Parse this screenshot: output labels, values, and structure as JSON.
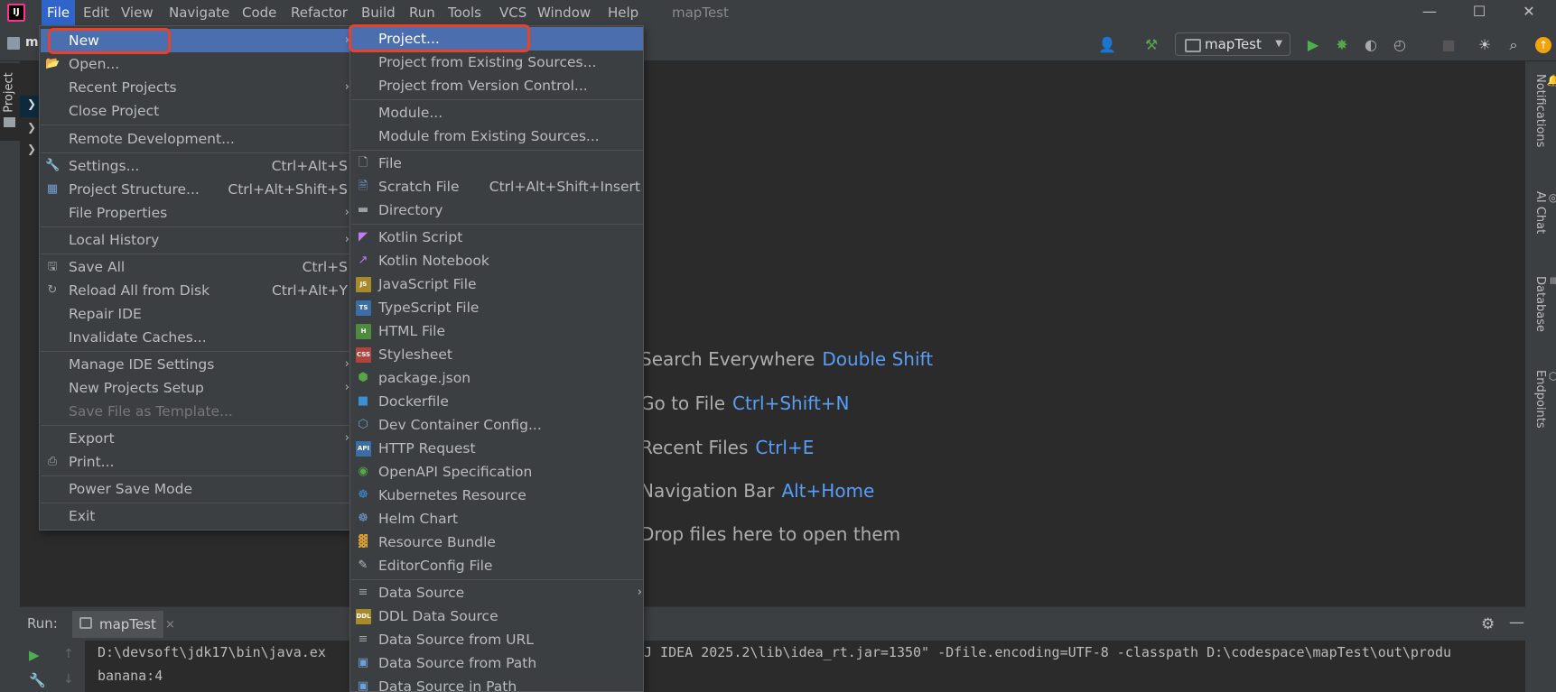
{
  "menubar": {
    "items": [
      "File",
      "Edit",
      "View",
      "Navigate",
      "Code",
      "Refactor",
      "Build",
      "Run",
      "Tools",
      "VCS",
      "Window",
      "Help"
    ],
    "window_title": "mapTest"
  },
  "window_controls": {
    "minimize": "—",
    "maximize": "☐",
    "close": "✕"
  },
  "toolbar": {
    "project_crumb": "m",
    "run_config": "mapTest",
    "run_config_arrow": "▼"
  },
  "left_stripe": {
    "project_tab": "Project"
  },
  "right_stripe": {
    "tabs": [
      "Notifications",
      "AI Chat",
      "Database",
      "Endpoints"
    ]
  },
  "editor_hints": [
    {
      "label": "Search Everywhere",
      "key": "Double Shift"
    },
    {
      "label": "Go to File",
      "key": "Ctrl+Shift+N"
    },
    {
      "label": "Recent Files",
      "key": "Ctrl+E"
    },
    {
      "label": "Navigation Bar",
      "key": "Alt+Home"
    },
    {
      "label": "Drop files here to open them",
      "key": ""
    }
  ],
  "run_window": {
    "label": "Run:",
    "tab": "mapTest",
    "tab_close": "×",
    "console_lines": [
      "D:\\devsoft\\jdk17\\bin\\java.ex",
      "banana:4"
    ],
    "console_tail": "J IDEA 2025.2\\lib\\idea_rt.jar=1350\" -Dfile.encoding=UTF-8 -classpath D:\\codespace\\mapTest\\out\\produ"
  },
  "file_menu": {
    "items": [
      {
        "label": "New",
        "shortcut": "",
        "arrow": "›"
      },
      {
        "label": "Open...",
        "shortcut": "",
        "arrow": ""
      },
      {
        "label": "Recent Projects",
        "shortcut": "",
        "arrow": "›"
      },
      {
        "label": "Close Project",
        "shortcut": "",
        "arrow": ""
      },
      {
        "label": "Remote Development...",
        "shortcut": "",
        "arrow": ""
      },
      {
        "label": "Settings...",
        "shortcut": "Ctrl+Alt+S",
        "arrow": ""
      },
      {
        "label": "Project Structure...",
        "shortcut": "Ctrl+Alt+Shift+S",
        "arrow": ""
      },
      {
        "label": "File Properties",
        "shortcut": "",
        "arrow": "›"
      },
      {
        "label": "Local History",
        "shortcut": "",
        "arrow": "›"
      },
      {
        "label": "Save All",
        "shortcut": "Ctrl+S",
        "arrow": ""
      },
      {
        "label": "Reload All from Disk",
        "shortcut": "Ctrl+Alt+Y",
        "arrow": ""
      },
      {
        "label": "Repair IDE",
        "shortcut": "",
        "arrow": ""
      },
      {
        "label": "Invalidate Caches...",
        "shortcut": "",
        "arrow": ""
      },
      {
        "label": "Manage IDE Settings",
        "shortcut": "",
        "arrow": "›"
      },
      {
        "label": "New Projects Setup",
        "shortcut": "",
        "arrow": "›"
      },
      {
        "label": "Save File as Template...",
        "shortcut": "",
        "arrow": ""
      },
      {
        "label": "Export",
        "shortcut": "",
        "arrow": "›"
      },
      {
        "label": "Print...",
        "shortcut": "",
        "arrow": ""
      },
      {
        "label": "Power Save Mode",
        "shortcut": "",
        "arrow": ""
      },
      {
        "label": "Exit",
        "shortcut": "",
        "arrow": ""
      }
    ]
  },
  "new_menu": {
    "items": [
      {
        "label": "Project...",
        "shortcut": ""
      },
      {
        "label": "Project from Existing Sources...",
        "shortcut": ""
      },
      {
        "label": "Project from Version Control...",
        "shortcut": ""
      },
      {
        "label": "Module...",
        "shortcut": ""
      },
      {
        "label": "Module from Existing Sources...",
        "shortcut": ""
      },
      {
        "label": "File",
        "shortcut": ""
      },
      {
        "label": "Scratch File",
        "shortcut": "Ctrl+Alt+Shift+Insert"
      },
      {
        "label": "Directory",
        "shortcut": ""
      },
      {
        "label": "Kotlin Script",
        "shortcut": ""
      },
      {
        "label": "Kotlin Notebook",
        "shortcut": ""
      },
      {
        "label": "JavaScript File",
        "shortcut": ""
      },
      {
        "label": "TypeScript File",
        "shortcut": ""
      },
      {
        "label": "HTML File",
        "shortcut": ""
      },
      {
        "label": "Stylesheet",
        "shortcut": ""
      },
      {
        "label": "package.json",
        "shortcut": ""
      },
      {
        "label": "Dockerfile",
        "shortcut": ""
      },
      {
        "label": "Dev Container Config...",
        "shortcut": ""
      },
      {
        "label": "HTTP Request",
        "shortcut": ""
      },
      {
        "label": "OpenAPI Specification",
        "shortcut": ""
      },
      {
        "label": "Kubernetes Resource",
        "shortcut": ""
      },
      {
        "label": "Helm Chart",
        "shortcut": ""
      },
      {
        "label": "Resource Bundle",
        "shortcut": ""
      },
      {
        "label": "EditorConfig File",
        "shortcut": ""
      },
      {
        "label": "Data Source",
        "shortcut": ""
      },
      {
        "label": "DDL Data Source",
        "shortcut": ""
      },
      {
        "label": "Data Source from URL",
        "shortcut": ""
      },
      {
        "label": "Data Source from Path",
        "shortcut": ""
      },
      {
        "label": "Data Source in Path",
        "shortcut": ""
      }
    ],
    "data_source_arrow": "›"
  },
  "icons": {
    "js_badge": "JS",
    "ts_badge": "TS",
    "html_badge": "H",
    "css_badge": "CSS",
    "api_badge": "API",
    "ddl_badge": "DDL"
  },
  "colors": {
    "selection": "#4b6eaf",
    "active_menu": "#2f65ca",
    "shortcut_blue": "#589df6",
    "annotation_red": "#e8412c",
    "run_green": "#4caf50"
  }
}
